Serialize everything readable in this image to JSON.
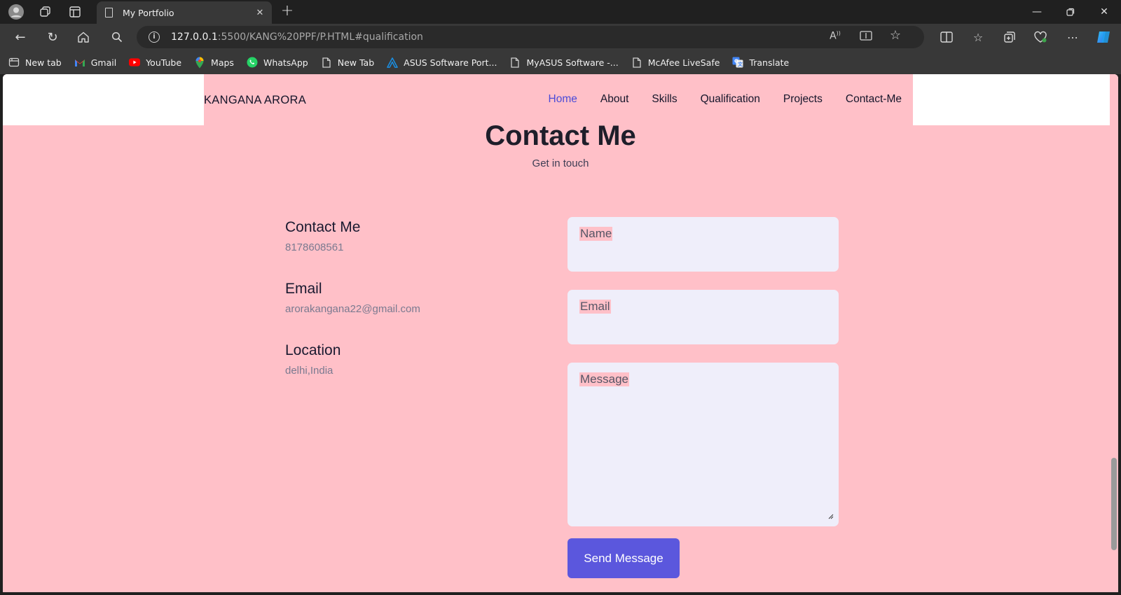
{
  "browser": {
    "tab_title": "My Portfolio",
    "url_host": "127.0.0.1",
    "url_rest": ":5500/KANG%20PPF/P.HTML#qualification",
    "bookmarks": [
      {
        "label": "New tab",
        "icon": "tabs-icon",
        "color": "#d0d0d0"
      },
      {
        "label": "Gmail",
        "icon": "gmail-icon",
        "color": "#ea4335"
      },
      {
        "label": "YouTube",
        "icon": "youtube-icon",
        "color": "#ff0000"
      },
      {
        "label": "Maps",
        "icon": "maps-icon",
        "color": "#34a853"
      },
      {
        "label": "WhatsApp",
        "icon": "whatsapp-icon",
        "color": "#25d366"
      },
      {
        "label": "New Tab",
        "icon": "page-icon",
        "color": "#d0d0d0"
      },
      {
        "label": "ASUS Software Port...",
        "icon": "asus-icon",
        "color": "#1a8fe3"
      },
      {
        "label": "MyASUS Software -...",
        "icon": "page-icon",
        "color": "#d0d0d0"
      },
      {
        "label": "McAfee LiveSafe",
        "icon": "page-icon",
        "color": "#d0d0d0"
      },
      {
        "label": "Translate",
        "icon": "translate-icon",
        "color": "#4285f4"
      }
    ]
  },
  "site": {
    "logo": "KANGANA ARORA",
    "nav": [
      {
        "label": "Home",
        "active": true
      },
      {
        "label": "About",
        "active": false
      },
      {
        "label": "Skills",
        "active": false
      },
      {
        "label": "Qualification",
        "active": false
      },
      {
        "label": "Projects",
        "active": false
      },
      {
        "label": "Contact-Me",
        "active": false
      }
    ]
  },
  "contact": {
    "title": "Contact Me",
    "subtitle": "Get in touch",
    "info": [
      {
        "heading": "Contact Me",
        "value": "8178608561"
      },
      {
        "heading": "Email",
        "value": "arorakangana22@gmail.com"
      },
      {
        "heading": "Location",
        "value": "delhi,India"
      }
    ],
    "form": {
      "name_placeholder": "Name",
      "email_placeholder": "Email",
      "message_placeholder": "Message",
      "submit_label": "Send Message"
    }
  },
  "colors": {
    "page_bg": "#ffc0c8",
    "accent": "#5b57dd",
    "active_link": "#4b4bd8",
    "field_bg": "#efeefa"
  }
}
